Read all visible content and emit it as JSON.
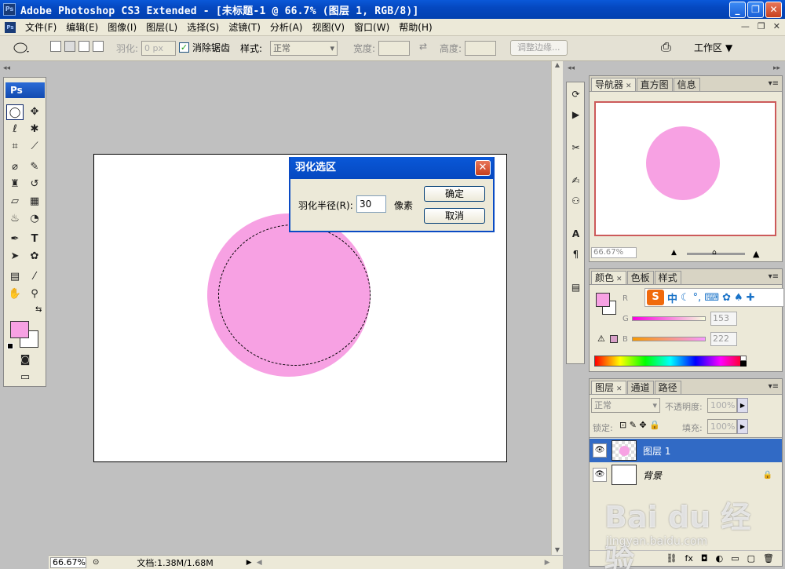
{
  "window": {
    "title": "Adobe Photoshop CS3 Extended - [未标题-1 @ 66.7% (图层 1, RGB/8)]",
    "app_icon": "Ps"
  },
  "menu": {
    "items": [
      "文件(F)",
      "编辑(E)",
      "图像(I)",
      "图层(L)",
      "选择(S)",
      "滤镜(T)",
      "分析(A)",
      "视图(V)",
      "窗口(W)",
      "帮助(H)"
    ]
  },
  "options": {
    "feather_label": "羽化:",
    "feather_value": "0 px",
    "antialias_label": "消除锯齿",
    "antialias_checked": true,
    "style_label": "样式:",
    "style_value": "正常",
    "width_label": "宽度:",
    "height_label": "高度:",
    "refine_edge": "调整边缘...",
    "workspace": "工作区"
  },
  "toolbox": {
    "logo": "Ps",
    "fg_color": "#f7a1e3",
    "bg_color": "#ffffff"
  },
  "status": {
    "zoom": "66.67%",
    "doc_info": "文档:1.38M/1.68M"
  },
  "dialog": {
    "title": "羽化选区",
    "radius_label": "羽化半径(R):",
    "radius_value": "30",
    "unit": "像素",
    "ok": "确定",
    "cancel": "取消"
  },
  "navigator": {
    "tabs": [
      "导航器",
      "直方图",
      "信息"
    ],
    "zoom": "66.67%"
  },
  "color": {
    "tabs": [
      "颜色",
      "色板",
      "样式"
    ],
    "r_label": "R",
    "g_label": "G",
    "b_label": "B",
    "g_value": "153",
    "b_value": "222",
    "ime": {
      "logo": "S",
      "lang": "中"
    }
  },
  "layers": {
    "tabs": [
      "图层",
      "通道",
      "路径"
    ],
    "blend_mode": "正常",
    "opacity_label": "不透明度:",
    "opacity_value": "100%",
    "lock_label": "锁定:",
    "fill_label": "填充:",
    "fill_value": "100%",
    "items": [
      {
        "name": "图层 1"
      },
      {
        "name": "背景"
      }
    ]
  },
  "watermark": {
    "logo": "Bai du 经验",
    "url": "jingyan.baidu.com"
  },
  "colors": {
    "pink": "#f7a1e3",
    "titlebar_blue": "#0548c0",
    "selection": "#316ac5"
  }
}
